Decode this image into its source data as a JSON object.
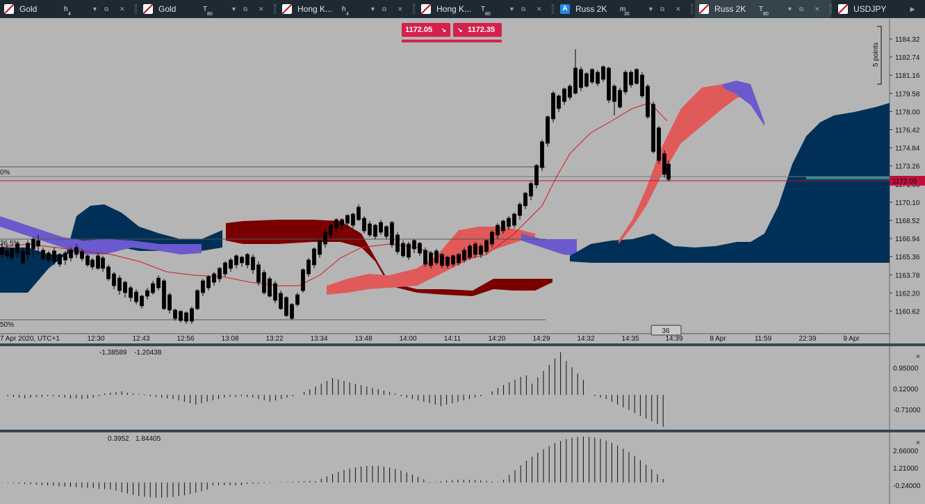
{
  "tabs": [
    {
      "symbol": "Gold",
      "tf_main": "h",
      "tf_sub": "4",
      "active": false,
      "icon": "red-chart-icon"
    },
    {
      "symbol": "Gold",
      "tf_main": "T",
      "tf_sub": "80",
      "active": false,
      "icon": "red-chart-icon"
    },
    {
      "symbol": "Hong K...",
      "tf_main": "h",
      "tf_sub": "4",
      "active": false,
      "icon": "red-chart-icon"
    },
    {
      "symbol": "Hong K...",
      "tf_main": "T",
      "tf_sub": "80",
      "active": false,
      "icon": "red-chart-icon"
    },
    {
      "symbol": "Russ 2K",
      "tf_main": "m",
      "tf_sub": "30",
      "active": false,
      "icon": "a-badge-icon",
      "badge": "A"
    },
    {
      "symbol": "Russ 2K",
      "tf_main": "T",
      "tf_sub": "80",
      "active": true,
      "icon": "red-chart-icon"
    },
    {
      "symbol": "USDJPY",
      "tf_main": "",
      "tf_sub": "",
      "active": false,
      "icon": "red-chart-icon"
    }
  ],
  "price_box": {
    "bid": "1172.05",
    "ask": "1172.35",
    "bid_arrow": "↘",
    "ask_arrow": "↘"
  },
  "scale_label": "5 points",
  "price_axis": [
    "1184.32",
    "1182.74",
    "1181.16",
    "1179.58",
    "1178.00",
    "1176.42",
    "1174.84",
    "1173.26",
    "1171.68",
    "1170.10",
    "1168.52",
    "1166.94",
    "1165.36",
    "1163.78",
    "1162.20",
    "1160.62"
  ],
  "current_price": "1172.05",
  "time_axis": [
    "7 Apr 2020, UTC+1",
    "12:30",
    "12:43",
    "12:56",
    "13:08",
    "13:22",
    "13:34",
    "13:48",
    "14:00",
    "14:11",
    "14:20",
    "14:29",
    "14:32",
    "14:35",
    "14:39",
    "8 Apr",
    "11:59",
    "22:39",
    "9 Apr"
  ],
  "cursor_label": "36",
  "fib_labels": {
    "top": "0%",
    "mid": "26.5%",
    "bottom": "50%"
  },
  "ind1": {
    "v1": "-1.38589",
    "v2": "-1.20438",
    "axis": [
      "0.95000",
      "0.12000",
      "-0.71000"
    ]
  },
  "ind2": {
    "v1": "0.3952",
    "v2": "1.84405",
    "axis": [
      "2.66000",
      "1.21000",
      "-0.24000"
    ]
  },
  "colors": {
    "tabbar": "#1e2a33",
    "bg": "#b5b5b5",
    "kumo_bull": "#e05a5a",
    "kumo_bear": "#7b0000",
    "kumo_blue": "#003057",
    "kumo_violet": "#6a5acd",
    "price_tag": "#c0103a"
  }
}
